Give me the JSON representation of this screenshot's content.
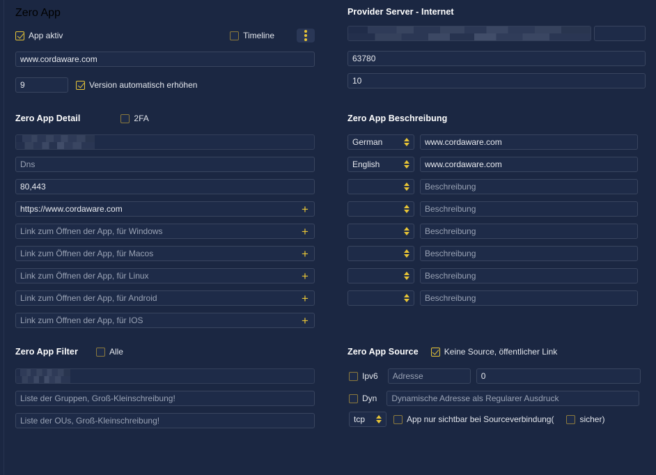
{
  "sections": {
    "zero_app": {
      "title": "Zero App",
      "app_active_label": "App aktiv",
      "app_active_checked": true,
      "timeline_label": "Timeline",
      "timeline_checked": false,
      "menu_icon": "kebab-menu-icon",
      "url_value": "www.cordaware.com",
      "version_value": "9",
      "auto_version_label": "Version automatisch erhöhen",
      "auto_version_checked": true
    },
    "zero_app_detail": {
      "title": "Zero App Detail",
      "twofa_label": "2FA",
      "twofa_checked": false,
      "name_value": "",
      "dns_placeholder": "Dns",
      "ports_value": "80,443",
      "link_value": "https://www.cordaware.com",
      "link_windows_placeholder": "Link zum Öffnen der App, für Windows",
      "link_macos_placeholder": "Link zum Öffnen der App, für Macos",
      "link_linux_placeholder": "Link zum Öffnen der App, für Linux",
      "link_android_placeholder": "Link zum Öffnen der App, für Android",
      "link_ios_placeholder": "Link zum Öffnen der App, für IOS",
      "plus_icon": "plus-icon"
    },
    "zero_app_filter": {
      "title": "Zero App Filter",
      "all_label": "Alle",
      "all_checked": false,
      "user_value": "",
      "groups_placeholder": "Liste der Gruppen, Groß-Kleinschreibung!",
      "ous_placeholder": "Liste der OUs, Groß-Kleinschreibung!"
    },
    "provider_server": {
      "title": "Provider Server - Internet",
      "server_value": "",
      "extra_value": "",
      "port_value": "63780",
      "count_value": "10"
    },
    "zero_app_beschreibung": {
      "title": "Zero App Beschreibung",
      "rows": [
        {
          "language": "German",
          "description": "www.cordaware.com",
          "is_placeholder": false
        },
        {
          "language": "English",
          "description": "www.cordaware.com",
          "is_placeholder": false
        },
        {
          "language": "",
          "description": "Beschreibung",
          "is_placeholder": true
        },
        {
          "language": "",
          "description": "Beschreibung",
          "is_placeholder": true
        },
        {
          "language": "",
          "description": "Beschreibung",
          "is_placeholder": true
        },
        {
          "language": "",
          "description": "Beschreibung",
          "is_placeholder": true
        },
        {
          "language": "",
          "description": "Beschreibung",
          "is_placeholder": true
        },
        {
          "language": "",
          "description": "Beschreibung",
          "is_placeholder": true
        }
      ]
    },
    "zero_app_source": {
      "title": "Zero App Source",
      "no_source_label": "Keine Source, öffentlicher Link",
      "no_source_checked": true,
      "ipv6_label": "Ipv6",
      "ipv6_checked": false,
      "address_placeholder": "Adresse",
      "mask_value": "0",
      "dyn_label": "Dyn",
      "dyn_checked": false,
      "dyn_placeholder": "Dynamische Adresse als Regularer Ausdruck",
      "protocol_value": "tcp",
      "visible_label": "App nur sichtbar bei Sourceverbindung(",
      "visible_checked": false,
      "secure_label": "sicher)",
      "secure_checked": false
    }
  },
  "colors": {
    "background": "#1b2742",
    "accent": "#e8c536",
    "field_bg": "#1e2b48",
    "field_border": "#39455f",
    "text": "#e8eaef",
    "placeholder": "#9aa3b5"
  }
}
